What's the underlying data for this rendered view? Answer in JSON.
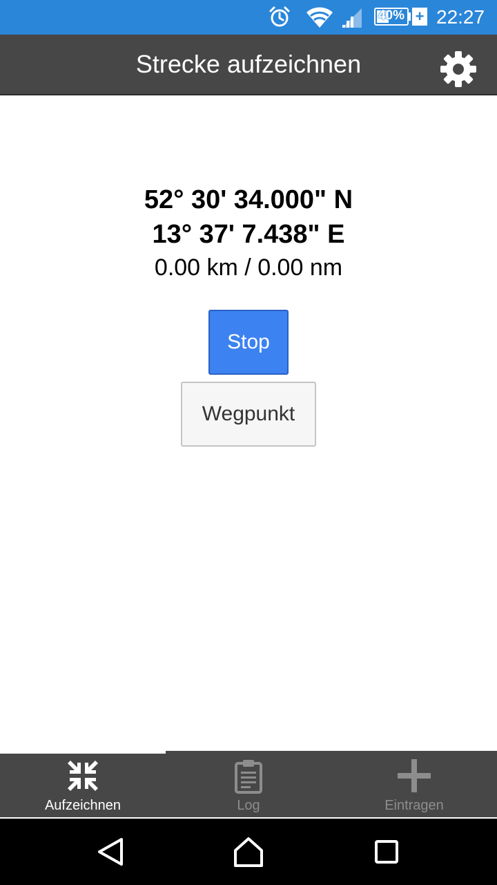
{
  "status_bar": {
    "time": "22:27",
    "battery_percent": "40%",
    "battery_level": 0.4,
    "charging_symbol": "+",
    "icons": [
      "alarm-icon",
      "wifi-icon",
      "signal-icon",
      "battery-icon",
      "charging-icon"
    ]
  },
  "toolbar": {
    "title": "Strecke aufzeichnen",
    "settings_icon": "gear-icon"
  },
  "position": {
    "latitude": "52° 30' 34.000\" N",
    "longitude": "13° 37' 7.438\" E",
    "distance": "0.00 km / 0.00 nm"
  },
  "actions": {
    "stop_label": "Stop",
    "waypoint_label": "Wegpunkt"
  },
  "tabs": [
    {
      "label": "Aufzeichnen",
      "icon": "compress-arrows-icon",
      "active": true
    },
    {
      "label": "Log",
      "icon": "clipboard-icon",
      "active": false
    },
    {
      "label": "Eintragen",
      "icon": "plus-icon",
      "active": false
    }
  ],
  "nav_bar": {
    "icons": [
      "back-icon",
      "home-icon",
      "recents-icon"
    ]
  },
  "colors": {
    "status_bar": "#2a86d9",
    "toolbar": "#474747",
    "accent_button": "#3d82f1",
    "tab_active": "#ffffff",
    "tab_inactive": "#8d8d8d"
  }
}
